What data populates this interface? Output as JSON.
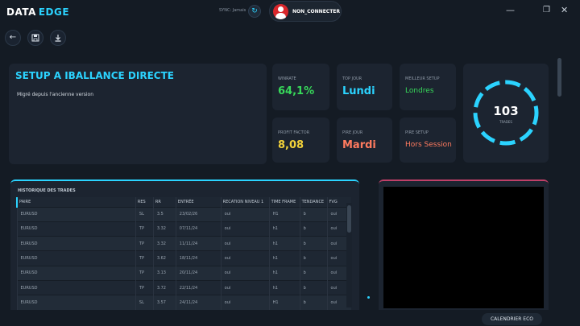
{
  "app": {
    "brand_left": "DATA",
    "brand_right": "EDGE"
  },
  "header": {
    "sync_text": "SYNC: Jamais",
    "sync_icon": "refresh-icon",
    "user_label": "NON_CONNECTER"
  },
  "window_controls": {
    "minimize": "—",
    "maximize": "❐",
    "close": "✕"
  },
  "toolbar": {
    "back": "←",
    "save": "💾",
    "download": "⤓"
  },
  "setup": {
    "title": "SETUP A IBALLANCE DIRECTE",
    "description": "Migré depuis l'ancienne version"
  },
  "stats": [
    {
      "label": "WINRATE",
      "value": "64,1%",
      "color": "#37d85a"
    },
    {
      "label": "TOP JOUR",
      "value": "Lundi",
      "color": "#2bd3ff"
    },
    {
      "label": "MEILLEUR SETUP",
      "value": "Londres",
      "color": "#37d85a"
    },
    {
      "label": "PROFIT FACTOR",
      "value": "8,08",
      "color": "#f2d23a"
    },
    {
      "label": "PIRE JOUR",
      "value": "Mardi",
      "color": "#ff7b5f"
    },
    {
      "label": "PIRE SETUP",
      "value": "Hors Session",
      "color": "#ff7b5f"
    }
  ],
  "donut": {
    "count": "103",
    "label": "TRADES",
    "color": "#2bd3ff"
  },
  "trades": {
    "title": "HISTORIQUE DES TRADES",
    "columns": [
      "PAIRE",
      "RES",
      "RR",
      "ENTRÉE",
      "RECATION NIVEAU 1",
      "TIME FRAME",
      "TENDANCE",
      "FVG"
    ],
    "rows": [
      [
        "EURUSD",
        "SL",
        "3.5",
        "23/02/26",
        "oui",
        "H1",
        "b",
        "oui"
      ],
      [
        "EURUSD",
        "TP",
        "3.32",
        "07/11/24",
        "oui",
        "h1",
        "b",
        "oui"
      ],
      [
        "EURUSD",
        "TP",
        "3.32",
        "11/11/24",
        "oui",
        "h1",
        "b",
        "oui"
      ],
      [
        "EURUSD",
        "TP",
        "3.62",
        "18/11/24",
        "oui",
        "h1",
        "b",
        "oui"
      ],
      [
        "EURUSD",
        "TP",
        "3.13",
        "20/11/24",
        "oui",
        "h1",
        "b",
        "oui"
      ],
      [
        "EURUSD",
        "TP",
        "3.72",
        "22/11/24",
        "oui",
        "h1",
        "b",
        "oui"
      ],
      [
        "EURUSD",
        "SL",
        "3.57",
        "24/11/24",
        "oui",
        "H1",
        "b",
        "oui"
      ]
    ]
  },
  "footer": {
    "eco_button": "CALENDRIER ECO"
  }
}
